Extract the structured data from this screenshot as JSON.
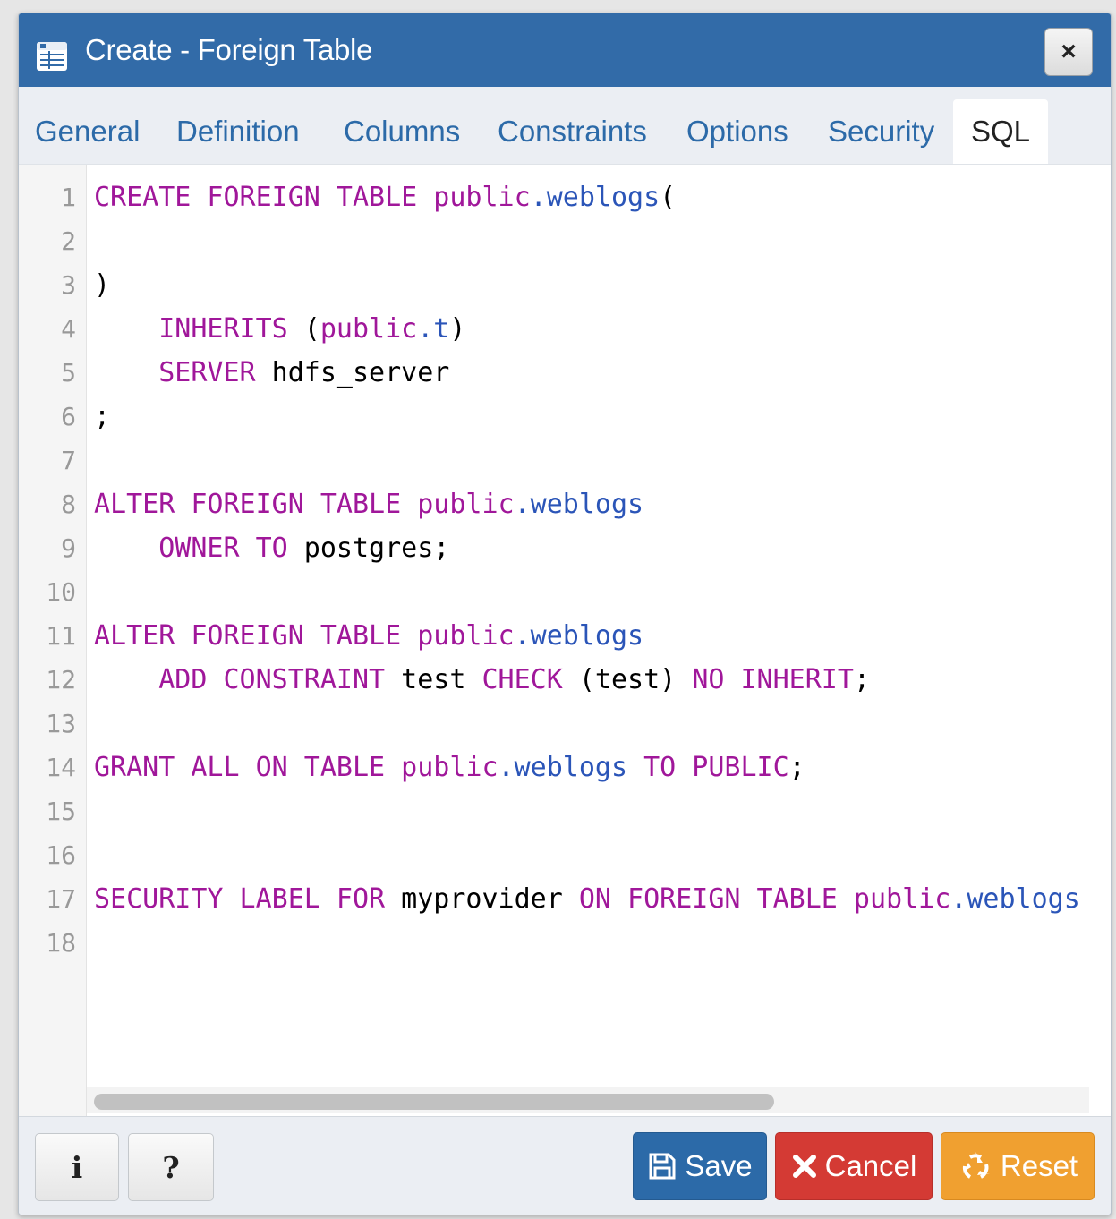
{
  "dialog": {
    "title": "Create - Foreign Table",
    "close_label": "×"
  },
  "tabs": [
    {
      "label": "General"
    },
    {
      "label": "Definition"
    },
    {
      "label": "Columns"
    },
    {
      "label": "Constraints"
    },
    {
      "label": "Options"
    },
    {
      "label": "Security"
    },
    {
      "label": "SQL"
    }
  ],
  "active_tab": "SQL",
  "editor": {
    "line_numbers": [
      "1",
      "2",
      "3",
      "4",
      "5",
      "6",
      "7",
      "8",
      "9",
      "10",
      "11",
      "12",
      "13",
      "14",
      "15",
      "16",
      "17",
      "18"
    ],
    "lines": [
      [
        {
          "t": "CREATE FOREIGN TABLE ",
          "c": "kw"
        },
        {
          "t": "public",
          "c": "kw"
        },
        {
          "t": ".weblogs",
          "c": "id"
        },
        {
          "t": "(",
          "c": "pl"
        }
      ],
      [],
      [
        {
          "t": ")",
          "c": "pl"
        }
      ],
      [
        {
          "t": "    ",
          "c": "pl"
        },
        {
          "t": "INHERITS",
          "c": "kw"
        },
        {
          "t": " (",
          "c": "pl"
        },
        {
          "t": "public",
          "c": "kw"
        },
        {
          "t": ".t",
          "c": "id"
        },
        {
          "t": ")",
          "c": "pl"
        }
      ],
      [
        {
          "t": "    ",
          "c": "pl"
        },
        {
          "t": "SERVER",
          "c": "kw"
        },
        {
          "t": " hdfs_server",
          "c": "pl"
        }
      ],
      [
        {
          "t": ";",
          "c": "pl"
        }
      ],
      [],
      [
        {
          "t": "ALTER FOREIGN TABLE ",
          "c": "kw"
        },
        {
          "t": "public",
          "c": "kw"
        },
        {
          "t": ".weblogs",
          "c": "id"
        }
      ],
      [
        {
          "t": "    ",
          "c": "pl"
        },
        {
          "t": "OWNER TO",
          "c": "kw"
        },
        {
          "t": " postgres;",
          "c": "pl"
        }
      ],
      [],
      [
        {
          "t": "ALTER FOREIGN TABLE ",
          "c": "kw"
        },
        {
          "t": "public",
          "c": "kw"
        },
        {
          "t": ".weblogs",
          "c": "id"
        }
      ],
      [
        {
          "t": "    ",
          "c": "pl"
        },
        {
          "t": "ADD CONSTRAINT",
          "c": "kw"
        },
        {
          "t": " test ",
          "c": "pl"
        },
        {
          "t": "CHECK",
          "c": "kw"
        },
        {
          "t": " (test) ",
          "c": "pl"
        },
        {
          "t": "NO INHERIT",
          "c": "kw"
        },
        {
          "t": ";",
          "c": "pl"
        }
      ],
      [],
      [
        {
          "t": "GRANT ALL ON TABLE ",
          "c": "kw"
        },
        {
          "t": "public",
          "c": "kw"
        },
        {
          "t": ".weblogs",
          "c": "id"
        },
        {
          "t": " TO PUBLIC",
          "c": "kw"
        },
        {
          "t": ";",
          "c": "pl"
        }
      ],
      [],
      [],
      [
        {
          "t": "SECURITY LABEL FOR",
          "c": "kw"
        },
        {
          "t": " myprovider ",
          "c": "pl"
        },
        {
          "t": "ON FOREIGN TABLE ",
          "c": "kw"
        },
        {
          "t": "public",
          "c": "kw"
        },
        {
          "t": ".weblogs",
          "c": "id"
        }
      ],
      []
    ]
  },
  "footer": {
    "info_label": "i",
    "help_label": "?",
    "save_label": "Save",
    "cancel_label": "Cancel",
    "reset_label": "Reset"
  },
  "colors": {
    "titlebar": "#326ba8",
    "keyword": "#a0179a",
    "identifier": "#2b55b8",
    "save": "#2c6aa8",
    "cancel": "#d43a34",
    "reset": "#f0a030"
  }
}
